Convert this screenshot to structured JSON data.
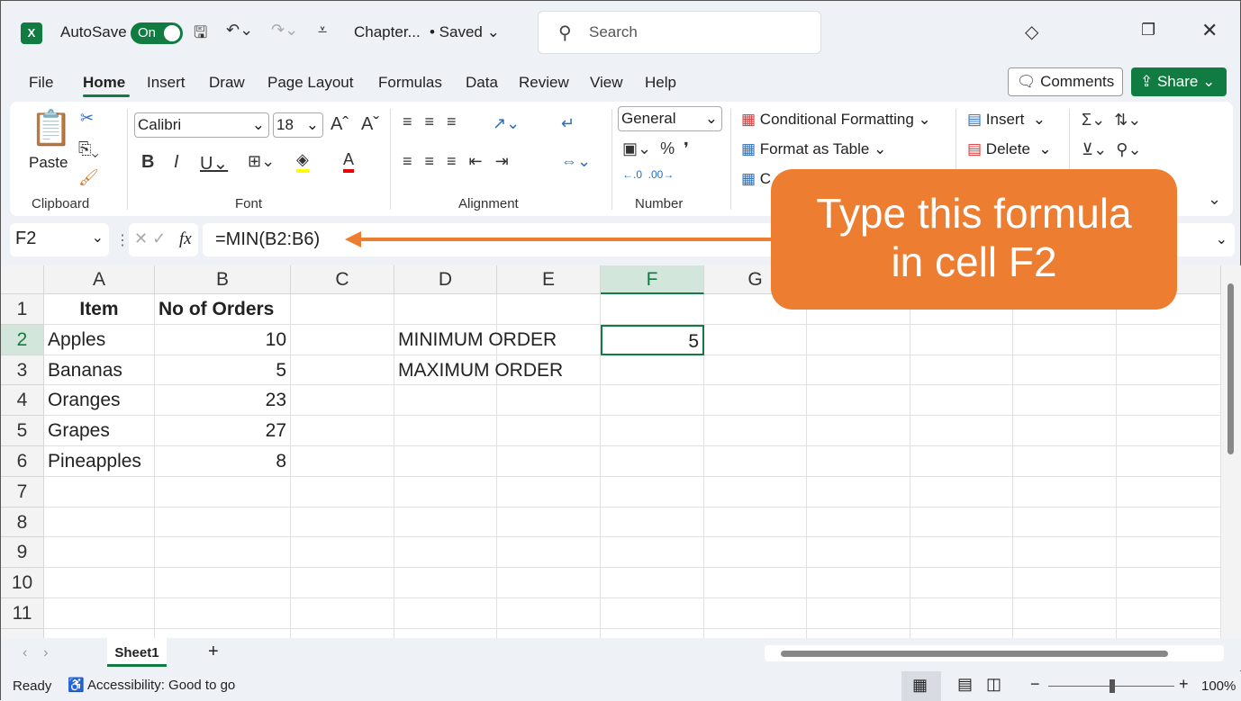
{
  "titlebar": {
    "autosave": "AutoSave",
    "toggle": "On",
    "doc": "Chapter...",
    "saved": "• Saved ⌄",
    "search": "Search"
  },
  "tabs": [
    "File",
    "Home",
    "Insert",
    "Draw",
    "Page Layout",
    "Formulas",
    "Data",
    "Review",
    "View",
    "Help"
  ],
  "buttons": {
    "comments": "Comments",
    "share": "Share"
  },
  "ribbon": {
    "paste": "Paste",
    "font": "Calibri",
    "size": "18",
    "number_format": "General",
    "conditional": "Conditional Formatting",
    "format_table": "Format as Table",
    "cell_styles": "C",
    "insert": "Insert",
    "delete": "Delete",
    "groups": {
      "clipboard": "Clipboard",
      "font": "Font",
      "alignment": "Alignment",
      "number": "Number"
    }
  },
  "formula_bar": {
    "name_box": "F2",
    "fx": "fx",
    "formula": "=MIN(B2:B6)"
  },
  "callout": {
    "line1": "Type this formula",
    "line2": "in cell F2",
    "color": "#ED7D31"
  },
  "columns": [
    "A",
    "B",
    "C",
    "D",
    "E",
    "F",
    "G"
  ],
  "rows": [
    "1",
    "2",
    "3",
    "4",
    "5",
    "6",
    "7",
    "8",
    "9",
    "10",
    "11"
  ],
  "cells": [
    {
      "ref": "A1",
      "v": "Item"
    },
    {
      "ref": "B1",
      "v": "No of Orders"
    },
    {
      "ref": "A2",
      "v": "Apples"
    },
    {
      "ref": "B2",
      "v": "10"
    },
    {
      "ref": "D2",
      "v": "MINIMUM ORDER"
    },
    {
      "ref": "F2",
      "v": "5"
    },
    {
      "ref": "A3",
      "v": "Bananas"
    },
    {
      "ref": "B3",
      "v": "5"
    },
    {
      "ref": "D3",
      "v": "MAXIMUM ORDER"
    },
    {
      "ref": "A4",
      "v": "Oranges"
    },
    {
      "ref": "B4",
      "v": "23"
    },
    {
      "ref": "A5",
      "v": "Grapes"
    },
    {
      "ref": "B5",
      "v": "27"
    },
    {
      "ref": "A6",
      "v": "Pineapples"
    },
    {
      "ref": "B6",
      "v": "8"
    }
  ],
  "selected_cell": "F2",
  "sheets": [
    "Sheet1"
  ],
  "status": {
    "ready": "Ready",
    "accessibility": "Accessibility: Good to go",
    "zoom": "100%"
  },
  "accent": "#107C41"
}
